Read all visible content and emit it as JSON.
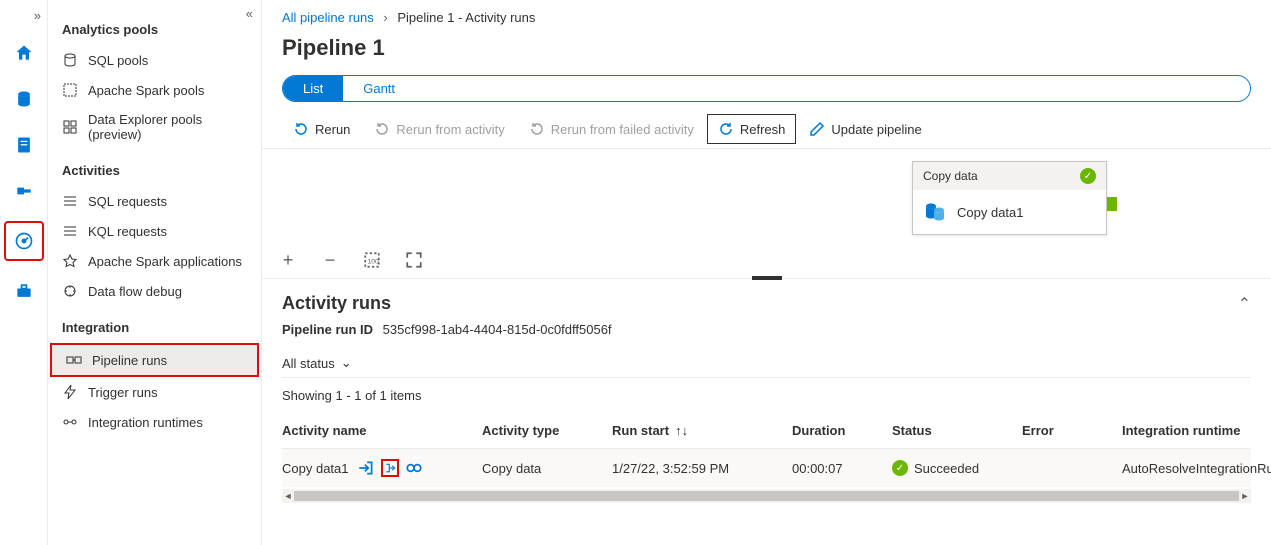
{
  "rail": {
    "items": [
      "home",
      "data",
      "develop",
      "integrate",
      "monitor",
      "manage"
    ]
  },
  "sidebar": {
    "groups": [
      {
        "title": "Analytics pools",
        "items": [
          {
            "label": "SQL pools"
          },
          {
            "label": "Apache Spark pools"
          },
          {
            "label": "Data Explorer pools (preview)"
          }
        ]
      },
      {
        "title": "Activities",
        "items": [
          {
            "label": "SQL requests"
          },
          {
            "label": "KQL requests"
          },
          {
            "label": "Apache Spark applications"
          },
          {
            "label": "Data flow debug"
          }
        ]
      },
      {
        "title": "Integration",
        "items": [
          {
            "label": "Pipeline runs"
          },
          {
            "label": "Trigger runs"
          },
          {
            "label": "Integration runtimes"
          }
        ]
      }
    ]
  },
  "breadcrumb": {
    "root": "All pipeline runs",
    "current": "Pipeline 1 - Activity runs"
  },
  "page_title": "Pipeline 1",
  "view_toggle": {
    "list": "List",
    "gantt": "Gantt"
  },
  "toolbar": {
    "rerun": "Rerun",
    "rerun_activity": "Rerun from activity",
    "rerun_failed": "Rerun from failed activity",
    "refresh": "Refresh",
    "update": "Update pipeline"
  },
  "node": {
    "head": "Copy data",
    "body": "Copy data1"
  },
  "activity_runs": {
    "title": "Activity runs",
    "run_id_label": "Pipeline run ID",
    "run_id": "535cf998-1ab4-4404-815d-0c0fdff5056f",
    "status_filter": "All status",
    "showing": "Showing 1 - 1 of 1 items",
    "columns": {
      "name": "Activity name",
      "type": "Activity type",
      "start": "Run start",
      "duration": "Duration",
      "status": "Status",
      "error": "Error",
      "runtime": "Integration runtime"
    },
    "rows": [
      {
        "name": "Copy data1",
        "type": "Copy data",
        "start": "1/27/22, 3:52:59 PM",
        "duration": "00:00:07",
        "status": "Succeeded",
        "error": "",
        "runtime": "AutoResolveIntegrationRuntime"
      }
    ]
  }
}
